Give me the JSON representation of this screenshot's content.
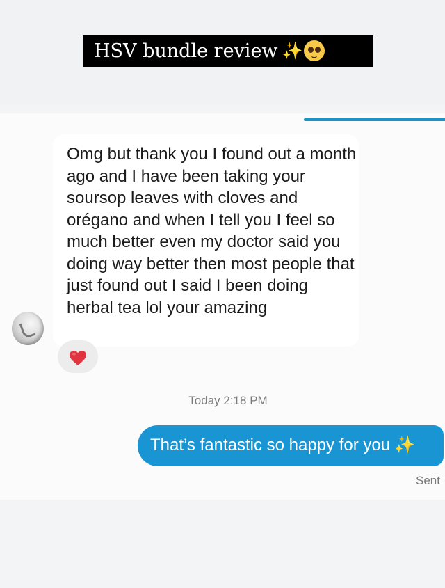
{
  "header": {
    "title": "HSV bundle review",
    "title_sparkle": "✨",
    "title_emoji_icon": "pleading-face-icon"
  },
  "conversation": {
    "incoming_message": "Omg but thank you I found out a month ago and I have been taking your soursop leaves with cloves and orégano and when I tell you I feel so much better even my doctor said you doing way better then most people that just found out I said I been doing herbal tea lol your amazing",
    "reaction_icon": "red-heart-icon",
    "timestamp": "Today 2:18 PM",
    "outgoing_message": "That’s fantastic so happy for you",
    "outgoing_sparkle": "✨",
    "status": "Sent"
  },
  "colors": {
    "banner_bg": "#000000",
    "outgoing_bubble": "#1a95d3",
    "accent_line": "#1b95c8",
    "heart": "#e0343f",
    "meta_text": "#7a7a7a"
  }
}
